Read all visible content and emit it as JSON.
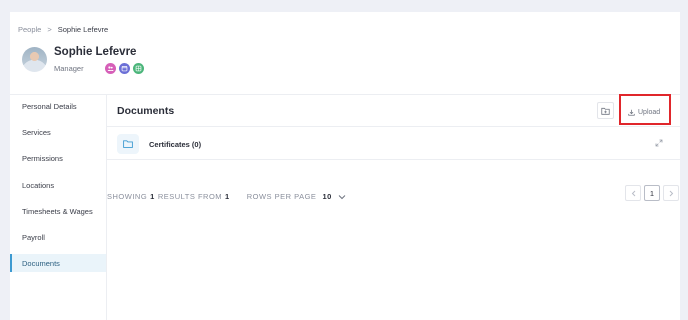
{
  "breadcrumb": {
    "root": "People",
    "separator": ">",
    "current": "Sophie Lefevre"
  },
  "profile": {
    "name": "Sophie Lefevre",
    "role": "Manager",
    "badges": [
      {
        "icon": "people-icon",
        "color": "#d65fb8"
      },
      {
        "icon": "calendar-icon",
        "color": "#6b6fd6"
      },
      {
        "icon": "grid-icon",
        "color": "#4bb57a"
      }
    ]
  },
  "sidebar": {
    "items": [
      {
        "label": "Personal Details"
      },
      {
        "label": "Services"
      },
      {
        "label": "Permissions"
      },
      {
        "label": "Locations"
      },
      {
        "label": "Timesheets & Wages"
      },
      {
        "label": "Payroll"
      },
      {
        "label": "Documents"
      }
    ],
    "active": "Documents"
  },
  "documents": {
    "title": "Documents",
    "upload_label": "Upload",
    "folders": [
      {
        "label": "Certificates (0)"
      }
    ],
    "paging": {
      "showing_prefix": "SHOWING",
      "showing_count": "1",
      "results_from_label": "RESULTS FROM",
      "results_total": "1",
      "rows_per_page_label": "ROWS PER PAGE",
      "rows_per_page_value": "10",
      "current_page": "1"
    }
  },
  "colors": {
    "accent": "#3d9ad1",
    "highlight": "#e0262b"
  }
}
